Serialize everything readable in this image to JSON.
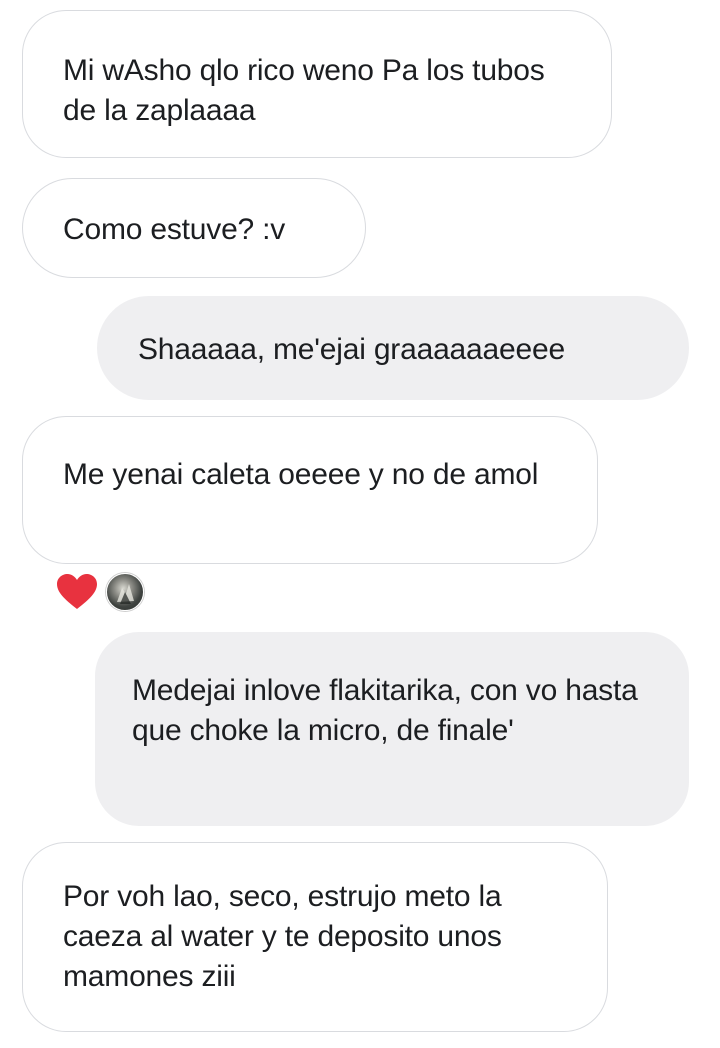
{
  "conversation": {
    "messages": [
      {
        "direction": "incoming",
        "text": "Mi wAsho qlo rico weno Pa los tubos de la zaplaaaa"
      },
      {
        "direction": "incoming",
        "text": "Como estuve? :v"
      },
      {
        "direction": "outgoing",
        "text": "Shaaaaa, me'ejai graaaaaaeeee"
      },
      {
        "direction": "incoming",
        "text": "Me yenai caleta oeeee y no de amol"
      },
      {
        "direction": "outgoing",
        "text": "Medejai inlove flakitarika, con vo hasta que choke la micro, de finale'"
      },
      {
        "direction": "incoming",
        "text": "Por voh lao, seco, estrujo meto la caeza al water y te deposito unos mamones ziii"
      }
    ],
    "reaction": {
      "on_message": 3,
      "icon": "heart-icon",
      "color": "#e8323f",
      "reactor_avatar": "avatar"
    }
  },
  "colors": {
    "incoming_bubble_bg": "#ffffff",
    "incoming_bubble_border": "#d9dbdf",
    "outgoing_bubble_bg": "#efeff1",
    "text": "#1c1e21"
  }
}
